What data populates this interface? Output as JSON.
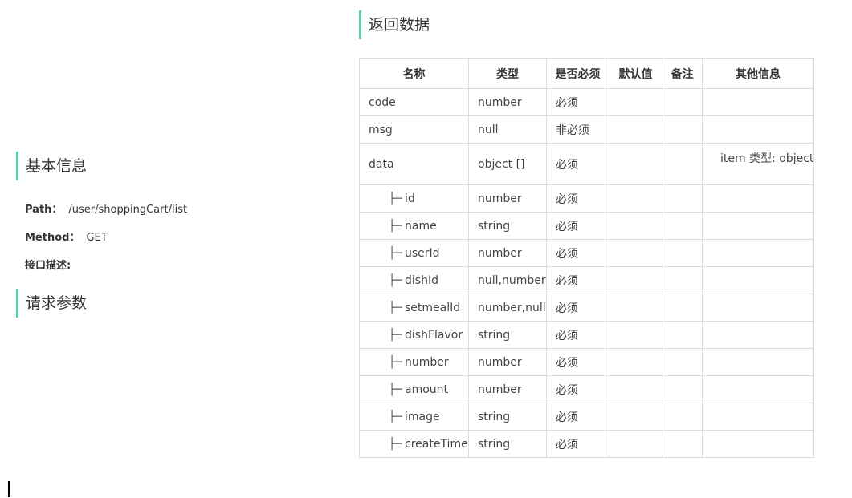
{
  "left": {
    "basic_info_title": "基本信息",
    "path_label": "Path：",
    "path_value": "/user/shoppingCart/list",
    "method_label": "Method：",
    "method_value": "GET",
    "desc_label": "接口描述:",
    "request_params_title": "请求参数"
  },
  "right": {
    "return_data_title": "返回数据",
    "columns": [
      "名称",
      "类型",
      "是否必须",
      "默认值",
      "备注",
      "其他信息"
    ],
    "rows": [
      {
        "name": "code",
        "type": "number",
        "required": "必须",
        "default": "",
        "note": "",
        "other": ""
      },
      {
        "name": "msg",
        "type": "null",
        "required": "非必须",
        "default": "",
        "note": "",
        "other": ""
      },
      {
        "name": "data",
        "type": "object []",
        "required": "必须",
        "default": "",
        "note": "",
        "other": "item 类型: object"
      },
      {
        "name": "id",
        "type": "number",
        "required": "必须",
        "default": "",
        "note": "",
        "other": "",
        "child": true
      },
      {
        "name": "name",
        "type": "string",
        "required": "必须",
        "default": "",
        "note": "",
        "other": "",
        "child": true
      },
      {
        "name": "userId",
        "type": "number",
        "required": "必须",
        "default": "",
        "note": "",
        "other": "",
        "child": true
      },
      {
        "name": "dishId",
        "type": "null,number",
        "required": "必须",
        "default": "",
        "note": "",
        "other": "",
        "child": true
      },
      {
        "name": "setmealId",
        "type": "number,null",
        "required": "必须",
        "default": "",
        "note": "",
        "other": "",
        "child": true
      },
      {
        "name": "dishFlavor",
        "type": "string",
        "required": "必须",
        "default": "",
        "note": "",
        "other": "",
        "child": true
      },
      {
        "name": "number",
        "type": "number",
        "required": "必须",
        "default": "",
        "note": "",
        "other": "",
        "child": true
      },
      {
        "name": "amount",
        "type": "number",
        "required": "必须",
        "default": "",
        "note": "",
        "other": "",
        "child": true
      },
      {
        "name": "image",
        "type": "string",
        "required": "必须",
        "default": "",
        "note": "",
        "other": "",
        "child": true
      },
      {
        "name": "createTime",
        "type": "string",
        "required": "必须",
        "default": "",
        "note": "",
        "other": "",
        "child": true
      }
    ],
    "tree_glyph": "├─"
  },
  "colors": {
    "accent": "#59d3a0",
    "border": "#dcdcdc"
  }
}
